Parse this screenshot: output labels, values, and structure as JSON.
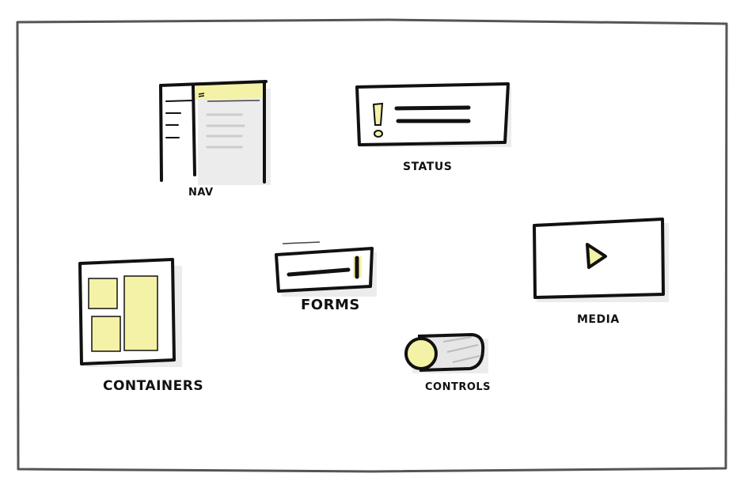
{
  "colors": {
    "ink": "#111111",
    "frame": "#555555",
    "highlight": "#f4f2a6",
    "shadow": "#dcdcdc",
    "background": "#ffffff"
  },
  "categories": [
    {
      "key": "nav",
      "label": "NAV",
      "icon": "sidebar-layout-icon"
    },
    {
      "key": "status",
      "label": "STATUS",
      "icon": "alert-banner-icon"
    },
    {
      "key": "forms",
      "label": "FORMS",
      "icon": "text-input-icon"
    },
    {
      "key": "media",
      "label": "MEDIA",
      "icon": "play-video-icon"
    },
    {
      "key": "containers",
      "label": "CONTAINERS",
      "icon": "grid-panels-icon"
    },
    {
      "key": "controls",
      "label": "CONTROLS",
      "icon": "toggle-switch-icon"
    }
  ]
}
